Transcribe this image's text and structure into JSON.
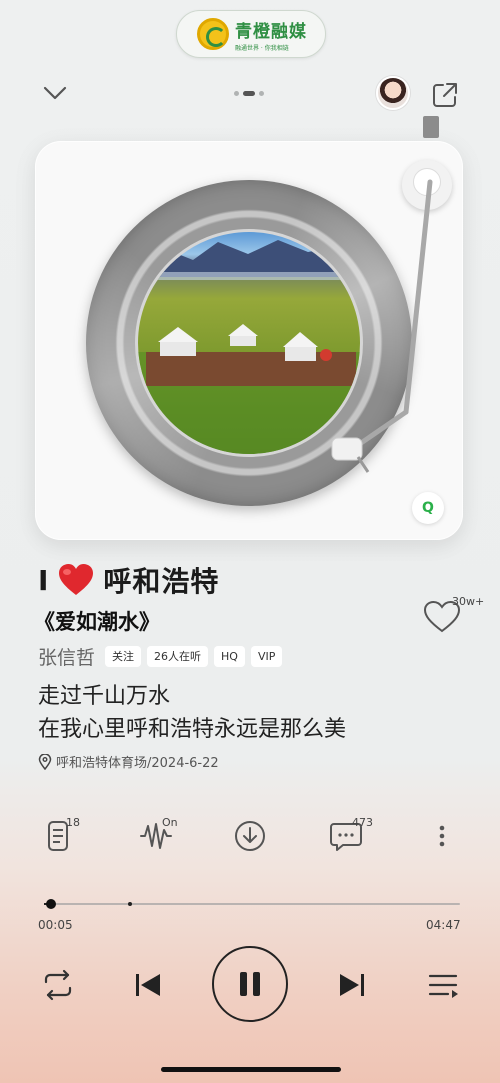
{
  "brand": {
    "name": "青橙融媒",
    "tagline": "融通世界 · 你我相链"
  },
  "header": {
    "page_dots": 3,
    "active_dot": 1
  },
  "song": {
    "title_prefix": "I",
    "title_city": "呼和浩特",
    "name": "《爱如潮水》",
    "artist": "张信哲",
    "tags": [
      "关注",
      "26人在听",
      "HQ",
      "VIP"
    ],
    "likes": "30w+",
    "lyric_line1": "走过千山万水",
    "lyric_line2": "在我心里呼和浩特永远是那么美",
    "location": "呼和浩特体育场/2024-6-22"
  },
  "actions": {
    "playlist_count": "18",
    "effect_label": "On",
    "comment_count": "473"
  },
  "progress": {
    "elapsed": "00:05",
    "total": "04:47",
    "fraction": 0.017
  },
  "colors": {
    "accent_green": "#2f8f43",
    "heart_red": "#e0282e"
  }
}
